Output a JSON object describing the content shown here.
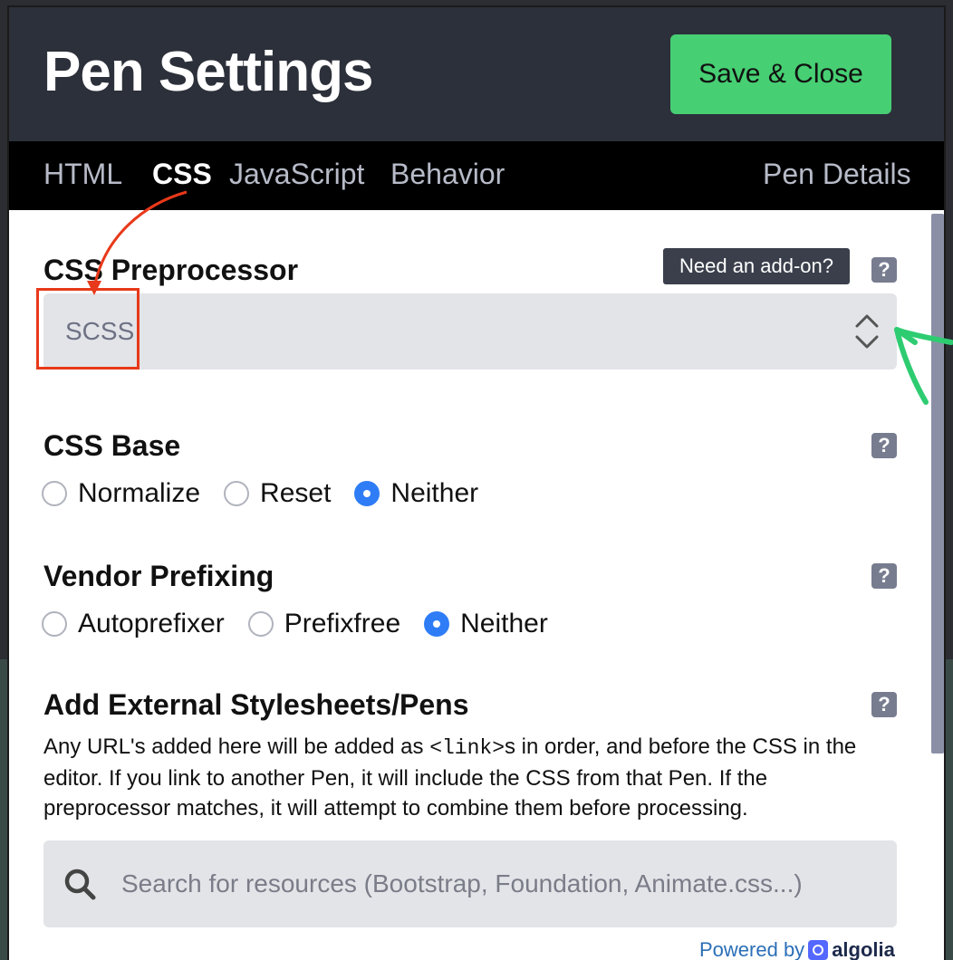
{
  "header": {
    "title": "Pen Settings",
    "save_label": "Save & Close"
  },
  "tabs": [
    {
      "label": "HTML",
      "active": false
    },
    {
      "label": "CSS",
      "active": true
    },
    {
      "label": "JavaScript",
      "active": false
    },
    {
      "label": "Behavior",
      "active": false
    },
    {
      "label": "Pen Details",
      "active": false
    }
  ],
  "preprocessor": {
    "title": "CSS Preprocessor",
    "addon_label": "Need an add-on?",
    "selected": "SCSS"
  },
  "css_base": {
    "title": "CSS Base",
    "options": [
      "Normalize",
      "Reset",
      "Neither"
    ],
    "selected": "Neither"
  },
  "vendor_prefixing": {
    "title": "Vendor Prefixing",
    "options": [
      "Autoprefixer",
      "Prefixfree",
      "Neither"
    ],
    "selected": "Neither"
  },
  "external": {
    "title": "Add External Stylesheets/Pens",
    "desc_before": "Any URL's added here will be added as ",
    "desc_code": "<link>",
    "desc_after": "s in order, and before the CSS in the editor. If you link to another Pen, it will include the CSS from that Pen. If the preprocessor matches, it will attempt to combine them before processing.",
    "search_placeholder": "Search for resources (Bootstrap, Foundation, Animate.css...)",
    "powered_by": "Powered by",
    "algolia": "algolia"
  },
  "help_label": "?",
  "colors": {
    "header_bg": "#2c303a",
    "save_green": "#47cf73",
    "radio_blue": "#2f7df6",
    "annotation_red": "#e8391a",
    "annotation_green": "#2ecc71"
  }
}
